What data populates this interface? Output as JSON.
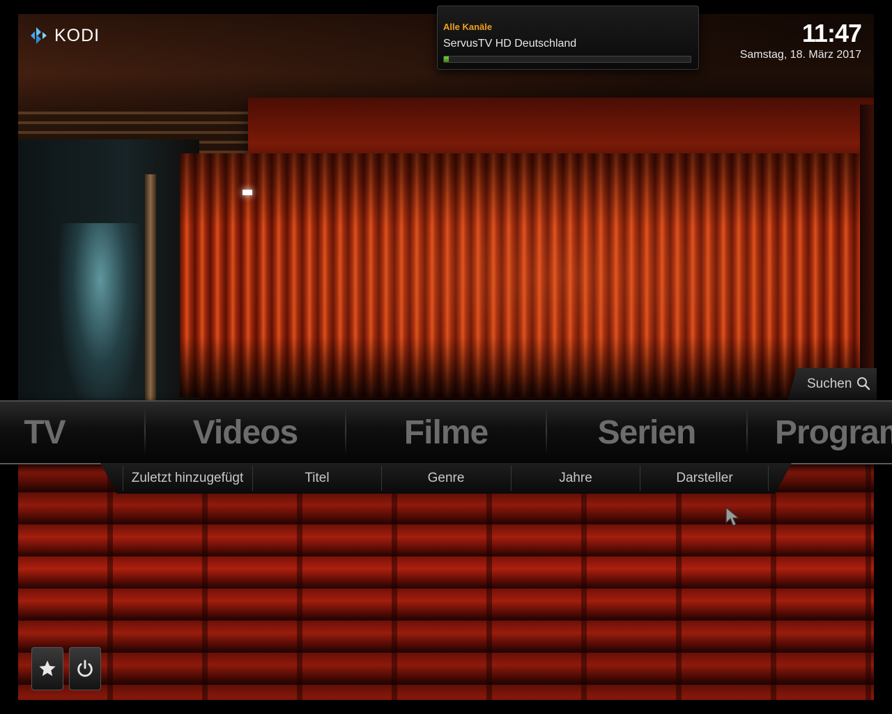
{
  "app": {
    "logo_text": "KODI"
  },
  "pvr": {
    "group": "Alle Kanäle",
    "channel": "ServusTV HD Deutschland",
    "progress": 0.02
  },
  "clock": {
    "time": "11:47",
    "date": "Samstag, 18. März 2017"
  },
  "search": {
    "label": "Suchen",
    "icon": "search-icon"
  },
  "main_menu": {
    "items": [
      {
        "label": "TV"
      },
      {
        "label": "Videos"
      },
      {
        "label": "Filme"
      },
      {
        "label": "Serien"
      },
      {
        "label": "Programme"
      }
    ]
  },
  "sub_menu": {
    "items": [
      {
        "label": "Zuletzt hinzugefügt"
      },
      {
        "label": "Titel"
      },
      {
        "label": "Genre"
      },
      {
        "label": "Jahre"
      },
      {
        "label": "Darsteller"
      }
    ]
  },
  "bottom_buttons": [
    {
      "icon": "star-icon"
    },
    {
      "icon": "power-icon"
    }
  ],
  "colors": {
    "pvr_group": "#f0a020",
    "progress": "#7bd23a",
    "menu_text": "#6c6c6c"
  }
}
